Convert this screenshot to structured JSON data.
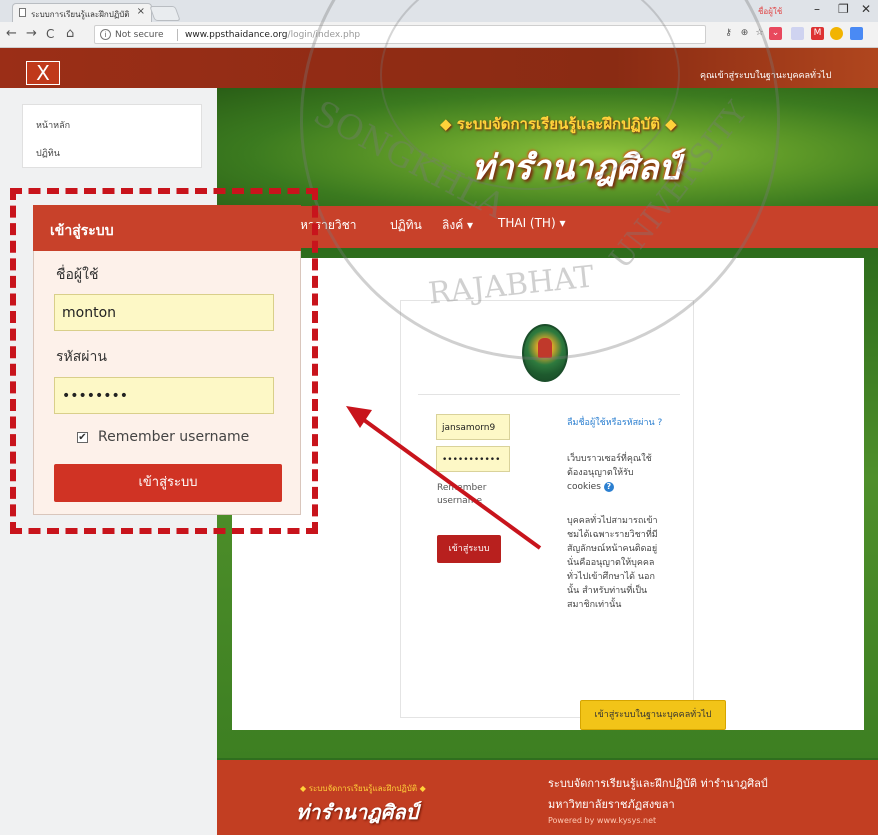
{
  "browser": {
    "tab_title": "ระบบการเรียนรู้และฝึกปฏิบัติ",
    "tab_close": "×",
    "window_user": "ชื่อผู้ใช้",
    "url_security": "Not secure",
    "url_host": "www.ppsthaidance.org",
    "url_path": "/login/index.php",
    "nav_back": "←",
    "nav_forward": "→",
    "nav_reload": "C",
    "nav_home": "⌂",
    "win_min": "–",
    "win_max": "❐",
    "win_close": "✕",
    "extensions": [
      "key-icon",
      "zoom-icon",
      "star-icon",
      "pocket-icon",
      "ext-icon",
      "gmail-icon",
      "chrome-icon",
      "docs-icon"
    ]
  },
  "site": {
    "close_label": "X",
    "guest_link": "คุณเข้าสู่ระบบในฐานะบุคคลทั่วไป",
    "title_line": "ระบบจัดการเรียนรู้และฝึกปฏิบัติ",
    "brand": "ท่ารำนาฎศิลป์",
    "nav": [
      "หารายวิชา",
      "ปฏิทิน",
      "ลิงค์ ▾",
      "THAI (TH) ▾"
    ],
    "sidebar": [
      "หน้าหลัก",
      "ปฏิทิน"
    ],
    "colors": {
      "primary_red": "#c8412a",
      "accent_yellow": "#f2c418",
      "green": "#3d7f22"
    }
  },
  "login": {
    "username_value": "jansamorn9",
    "password_value": "•••••••••••",
    "remember_label": "Remember username",
    "submit_label": "เข้าสู่ระบบ",
    "forgot_text": "ลืมชื่อผู้ใช้หรือรหัสผ่าน ?",
    "cookies_text": "เว็บบราวเซอร์ที่คุณใช้ต้องอนุญาตให้รับ cookies",
    "guest_note": "บุคคลทั่วไปสามารถเข้าชมได้เฉพาะรายวิชาที่มีสัญลักษณ์หน้าคนติดอยู่ นั่นคืออนุญาตให้บุคคลทั่วไปเข้าศึกษาได้ นอกนั้น สำหรับท่านที่เป็นสมาชิกเท่านั้น",
    "guest_button": "เข้าสู่ระบบในฐานะบุคคลทั่วไป"
  },
  "inset": {
    "title": "เข้าสู่ระบบ",
    "username_label": "ชื่อผู้ใช้",
    "username_value": "monton",
    "password_label": "รหัสผ่าน",
    "password_value": "••••••••",
    "remember_check": "✔",
    "remember_label": "Remember username",
    "submit_label": "เข้าสู่ระบบ"
  },
  "footer": {
    "left_title": "ระบบจัดการเรียนรู้และฝึกปฏิบัติ",
    "left_brand": "ท่ารำนาฎศิลป์",
    "line1": "ระบบจัดการเรียนรู้และฝึกปฏิบัติ ท่ารำนาฎศิลป์",
    "line2": "มหาวิทยาลัยราชภัฏสงขลา",
    "powered": "Powered by www.kysys.net"
  },
  "watermark": {
    "arc1": "SONGKHLA",
    "arc2": "RAJABHAT",
    "arc3": "UNIVERSITY"
  }
}
